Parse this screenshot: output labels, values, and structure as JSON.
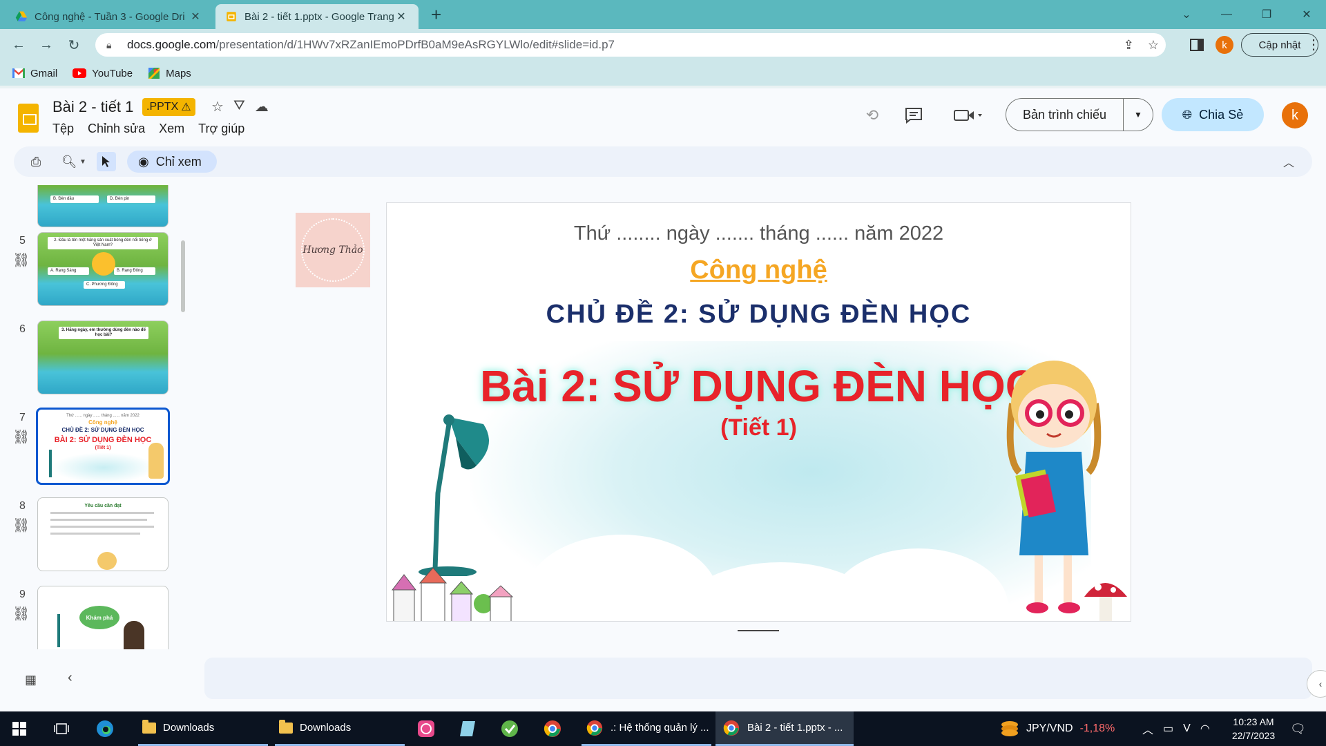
{
  "browser": {
    "tabs": [
      {
        "title": "Công nghệ - Tuần 3 - Google Dri",
        "active": false
      },
      {
        "title": "Bài 2 - tiết 1.pptx - Google Trang",
        "active": true
      }
    ],
    "new_tab": "+",
    "address": {
      "host": "docs.google.com",
      "path": "/presentation/d/1HWv7xRZanIEmoPDrfB0aM9eAsRGYLWlo/edit#slide=id.p7"
    },
    "profile_initial": "k",
    "update_label": "Cập nhật",
    "bookmarks": [
      {
        "label": "Gmail",
        "icon": "gmail-icon"
      },
      {
        "label": "YouTube",
        "icon": "youtube-icon"
      },
      {
        "label": "Maps",
        "icon": "maps-icon"
      }
    ]
  },
  "slides_app": {
    "doc_title": "Bài 2 - tiết 1",
    "format_badge": ".PPTX",
    "menus": [
      "Tệp",
      "Chỉnh sửa",
      "Xem",
      "Trợ giúp"
    ],
    "present_label": "Bản trình chiếu",
    "share_label": "Chia Sẻ",
    "user_initial": "k",
    "view_mode_label": "Chỉ xem"
  },
  "filmstrip": {
    "selected": 7,
    "thumbnails": [
      {
        "number": "5",
        "question": "2. Đâu là tên một hãng sản xuất bóng đèn nổi tiếng ở Việt Nam?",
        "options": [
          "A. Rạng Sáng",
          "B. Rạng Đông",
          "C. Phương Đông"
        ]
      },
      {
        "number": "6",
        "question": "3. Hằng ngày, em thường dùng đèn nào để học bài?"
      },
      {
        "number": "7",
        "mini_date": "Thứ ...... ngày ...... tháng ...... năm 2022",
        "mini_subject": "Công nghệ",
        "mini_topic": "CHỦ ĐỀ 2: SỬ DỤNG ĐÈN HỌC",
        "mini_lesson": "BÀI 2: SỬ DỤNG ĐÈN HỌC",
        "mini_period": "(Tiết 1)"
      },
      {
        "number": "8",
        "heading": "Yêu cầu cần đạt"
      },
      {
        "number": "9",
        "bubble": "Khám phá"
      }
    ],
    "partial_top_options": [
      "B. Đèn dầu",
      "D. Đèn pin"
    ]
  },
  "slide": {
    "sticker_text": "Hương Thảo",
    "date_line": "Thứ ........ ngày ....... tháng ...... năm 2022",
    "subject": "Công nghệ",
    "topic": "CHỦ ĐỀ 2: SỬ DỤNG ĐÈN HỌC",
    "lesson": "Bài 2: SỬ DỤNG ĐÈN HỌC",
    "period": "(Tiết 1)"
  },
  "taskbar": {
    "items": [
      "Downloads",
      "Downloads",
      ".: Hệ thống quản lý ...",
      "Bài 2 - tiết 1.pptx - ..."
    ],
    "currency_pair": "JPY/VND",
    "currency_change": "-1,18%",
    "time": "10:23 AM",
    "date": "22/7/2023"
  },
  "colors": {
    "tab_bar": "#5bb8be",
    "toolbar": "#cde7ea",
    "share_button": "#c2e7ff",
    "accent_blue": "#0b57d0",
    "avatar": "#e8710a",
    "pptx_badge": "#f4b400",
    "lesson_red": "#e8232a",
    "topic_navy": "#1b2f6b",
    "subject_orange": "#f5a623",
    "currency_down": "#ff6b6b"
  }
}
